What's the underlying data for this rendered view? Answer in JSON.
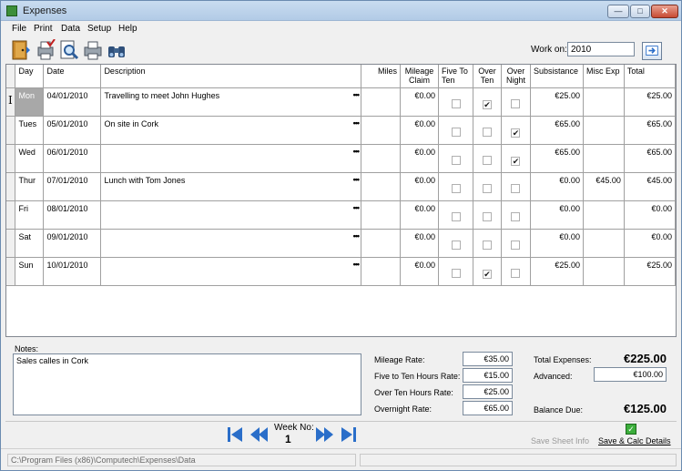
{
  "window": {
    "title": "Expenses"
  },
  "menu": [
    "File",
    "Print",
    "Data",
    "Setup",
    "Help"
  ],
  "toolbar": {
    "icons": [
      "exit-door-icon",
      "print-check-icon",
      "print-preview-icon",
      "printer-icon",
      "binoculars-icon"
    ],
    "work_on_label": "Work on:",
    "work_on_value": "2010"
  },
  "grid": {
    "headers": [
      "Day",
      "Date",
      "Description",
      "Miles",
      "Mileage Claim",
      "Five To Ten",
      "Over Ten",
      "Over Night",
      "Subsistance",
      "Misc Exp",
      "Total"
    ],
    "rows": [
      {
        "day": "Mon",
        "date": "04/01/2010",
        "description": "Travelling to meet John Hughes",
        "miles": "",
        "mileage": "€0.00",
        "five": false,
        "over": true,
        "night": false,
        "subsistance": "€25.00",
        "misc": "",
        "total": "€25.00"
      },
      {
        "day": "Tues",
        "date": "05/01/2010",
        "description": "On site in Cork",
        "miles": "",
        "mileage": "€0.00",
        "five": false,
        "over": false,
        "night": true,
        "subsistance": "€65.00",
        "misc": "",
        "total": "€65.00"
      },
      {
        "day": "Wed",
        "date": "06/01/2010",
        "description": "",
        "miles": "",
        "mileage": "€0.00",
        "five": false,
        "over": false,
        "night": true,
        "subsistance": "€65.00",
        "misc": "",
        "total": "€65.00"
      },
      {
        "day": "Thur",
        "date": "07/01/2010",
        "description": "Lunch with Tom Jones",
        "miles": "",
        "mileage": "€0.00",
        "five": false,
        "over": false,
        "night": false,
        "subsistance": "€0.00",
        "misc": "€45.00",
        "total": "€45.00"
      },
      {
        "day": "Fri",
        "date": "08/01/2010",
        "description": "",
        "miles": "",
        "mileage": "€0.00",
        "five": false,
        "over": false,
        "night": false,
        "subsistance": "€0.00",
        "misc": "",
        "total": "€0.00"
      },
      {
        "day": "Sat",
        "date": "09/01/2010",
        "description": "",
        "miles": "",
        "mileage": "€0.00",
        "five": false,
        "over": false,
        "night": false,
        "subsistance": "€0.00",
        "misc": "",
        "total": "€0.00"
      },
      {
        "day": "Sun",
        "date": "10/01/2010",
        "description": "",
        "miles": "",
        "mileage": "€0.00",
        "five": false,
        "over": true,
        "night": false,
        "subsistance": "€25.00",
        "misc": "",
        "total": "€25.00"
      }
    ]
  },
  "notes": {
    "label": "Notes:",
    "value": "Sales calles in Cork"
  },
  "rates": {
    "mileage_label": "Mileage Rate:",
    "mileage_value": "€35.00",
    "five_ten_label": "Five to Ten Hours Rate:",
    "five_ten_value": "€15.00",
    "over_ten_label": "Over Ten Hours Rate:",
    "over_ten_value": "€25.00",
    "overnight_label": "Overnight Rate:",
    "overnight_value": "€65.00"
  },
  "totals": {
    "total_label": "Total Expenses:",
    "total_value": "€225.00",
    "advanced_label": "Advanced:",
    "advanced_value": "€100.00",
    "balance_label": "Balance Due:",
    "balance_value": "€125.00"
  },
  "nav": {
    "week_label": "Week No:",
    "week_value": "1"
  },
  "actions": {
    "save_sheet_info": "Save Sheet Info",
    "save_calc": "Save & Calc Details"
  },
  "status": {
    "path": "C:\\Program Files (x86)\\Computech\\Expenses\\Data"
  }
}
